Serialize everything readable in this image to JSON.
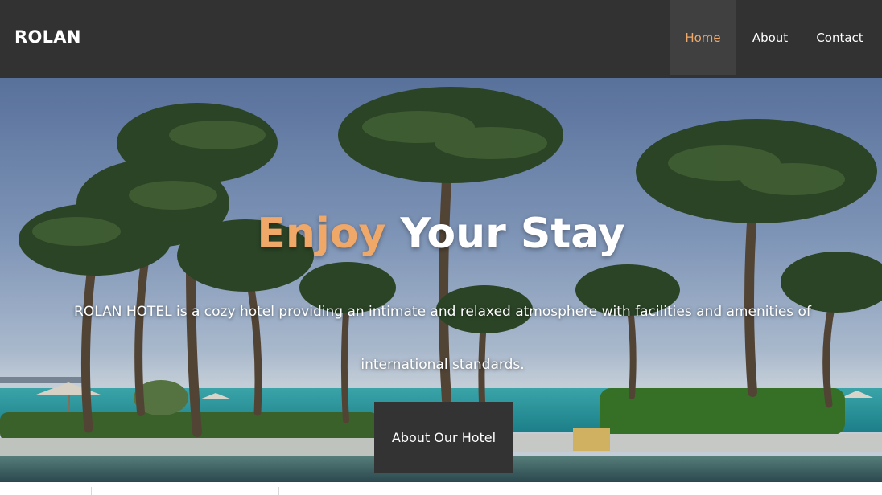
{
  "navbar": {
    "brand": "ROLAN",
    "links": [
      {
        "label": "Home",
        "active": true
      },
      {
        "label": "About",
        "active": false
      },
      {
        "label": "Contact",
        "active": false
      }
    ]
  },
  "hero": {
    "title_accent": "Enjoy",
    "title_rest": "Your Stay",
    "description": "ROLAN HOTEL is a cozy hotel providing an intimate and relaxed atmosphere with facilities and amenities of international standards.",
    "button_label": "About Our Hotel"
  },
  "colors": {
    "navbar": "#323232",
    "nav_active_bg": "#404040",
    "accent": "#f0a868",
    "button_bg": "#333333"
  }
}
